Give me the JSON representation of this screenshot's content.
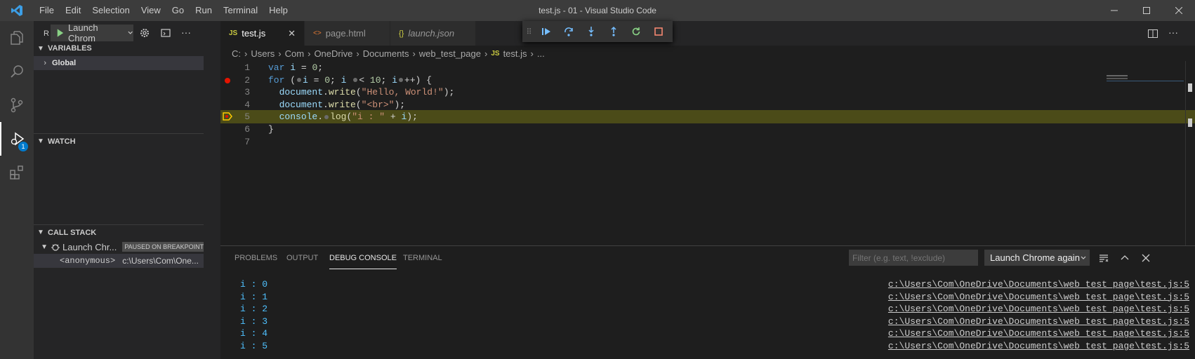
{
  "window": {
    "title": "test.js - 01 - Visual Studio Code"
  },
  "menu": [
    "File",
    "Edit",
    "Selection",
    "View",
    "Go",
    "Run",
    "Terminal",
    "Help"
  ],
  "activity": {
    "debug_badge": "1"
  },
  "sidebar": {
    "run_label": "R",
    "launch_config": "Launch Chrom",
    "variables_title": "VARIABLES",
    "global_label": "Global",
    "watch_title": "WATCH",
    "callstack_title": "CALL STACK",
    "callstack_session": "Launch Chr...",
    "paused_badge": "PAUSED ON BREAKPOINT",
    "frame_name": "<anonymous>",
    "frame_path": "c:\\Users\\Com\\One..."
  },
  "tabs": [
    {
      "icon": "JS",
      "label": "test.js",
      "active": true
    },
    {
      "icon": "<>",
      "label": "page.html",
      "active": false
    },
    {
      "icon": "{}",
      "label": "launch.json",
      "active": false
    }
  ],
  "breadcrumb": [
    "C:",
    "Users",
    "Com",
    "OneDrive",
    "Documents",
    "web_test_page",
    "test.js",
    "..."
  ],
  "code": [
    {
      "n": "1",
      "parts": [
        [
          "kw",
          "var"
        ],
        [
          "txt",
          " "
        ],
        [
          "var",
          "i"
        ],
        [
          "txt",
          " = "
        ],
        [
          "num",
          "0"
        ],
        [
          "txt",
          ";"
        ]
      ]
    },
    {
      "n": "2",
      "parts": [
        [
          "kw",
          "for"
        ],
        [
          "txt",
          " ("
        ],
        [
          "bp",
          ""
        ],
        [
          "var",
          "i"
        ],
        [
          "txt",
          " = "
        ],
        [
          "num",
          "0"
        ],
        [
          "txt",
          "; "
        ],
        [
          "var",
          "i"
        ],
        [
          "txt",
          " "
        ],
        [
          "bp",
          ""
        ],
        [
          "txt",
          "< "
        ],
        [
          "num",
          "10"
        ],
        [
          "txt",
          "; "
        ],
        [
          "var",
          "i"
        ],
        [
          "bp",
          ""
        ],
        [
          "txt",
          "++) {"
        ]
      ]
    },
    {
      "n": "3",
      "parts": [
        [
          "txt",
          "  "
        ],
        [
          "var",
          "document"
        ],
        [
          "txt",
          "."
        ],
        [
          "fn",
          "write"
        ],
        [
          "txt",
          "("
        ],
        [
          "str",
          "\"Hello, World!\""
        ],
        [
          "txt",
          ");"
        ]
      ]
    },
    {
      "n": "4",
      "parts": [
        [
          "txt",
          "  "
        ],
        [
          "var",
          "document"
        ],
        [
          "txt",
          "."
        ],
        [
          "fn",
          "write"
        ],
        [
          "txt",
          "("
        ],
        [
          "str",
          "\"<br>\""
        ],
        [
          "txt",
          ");"
        ]
      ]
    },
    {
      "n": "5",
      "parts": [
        [
          "txt",
          "  "
        ],
        [
          "var",
          "console"
        ],
        [
          "txt",
          "."
        ],
        [
          "bp",
          ""
        ],
        [
          "fn",
          "log"
        ],
        [
          "txt",
          "("
        ],
        [
          "str",
          "\"i : \""
        ],
        [
          "txt",
          " + "
        ],
        [
          "var",
          "i"
        ],
        [
          "txt",
          ");"
        ]
      ]
    },
    {
      "n": "6",
      "parts": [
        [
          "txt",
          "}"
        ]
      ]
    },
    {
      "n": "7",
      "parts": []
    }
  ],
  "panel": {
    "tabs": [
      "PROBLEMS",
      "OUTPUT",
      "DEBUG CONSOLE",
      "TERMINAL"
    ],
    "active_tab": "DEBUG CONSOLE",
    "filter_placeholder": "Filter (e.g. text, !exclude)",
    "session_select": "Launch Chrome against",
    "output": [
      {
        "text": "i : 0",
        "source": "c:\\Users\\Com\\OneDrive\\Documents\\web_test_page\\test.js:5"
      },
      {
        "text": "i : 1",
        "source": "c:\\Users\\Com\\OneDrive\\Documents\\web_test_page\\test.js:5"
      },
      {
        "text": "i : 2",
        "source": "c:\\Users\\Com\\OneDrive\\Documents\\web_test_page\\test.js:5"
      },
      {
        "text": "i : 3",
        "source": "c:\\Users\\Com\\OneDrive\\Documents\\web_test_page\\test.js:5"
      },
      {
        "text": "i : 4",
        "source": "c:\\Users\\Com\\OneDrive\\Documents\\web_test_page\\test.js:5"
      },
      {
        "text": "i : 5",
        "source": "c:\\Users\\Com\\OneDrive\\Documents\\web_test_page\\test.js:5"
      }
    ]
  },
  "colors": {
    "accent": "#007acc",
    "breakpoint": "#e51400",
    "current_line": "#4b4b18",
    "js_icon": "#cbcb41",
    "html_icon": "#e37933"
  }
}
